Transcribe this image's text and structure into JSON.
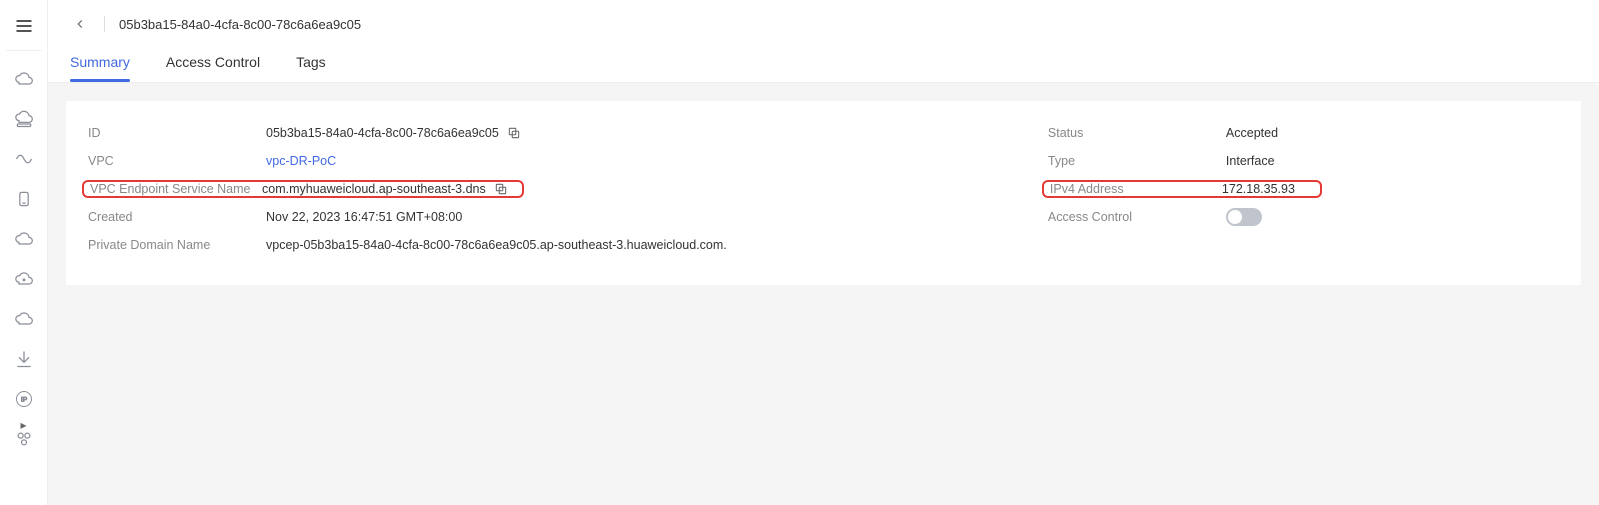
{
  "breadcrumb": {
    "title": "05b3ba15-84a0-4cfa-8c00-78c6a6ea9c05"
  },
  "tabs": [
    {
      "label": "Summary",
      "active": true
    },
    {
      "label": "Access Control",
      "active": false
    },
    {
      "label": "Tags",
      "active": false
    }
  ],
  "details": {
    "left": {
      "id_label": "ID",
      "id_value": "05b3ba15-84a0-4cfa-8c00-78c6a6ea9c05",
      "vpc_label": "VPC",
      "vpc_value": "vpc-DR-PoC",
      "svc_label": "VPC Endpoint Service Name",
      "svc_value": "com.myhuaweicloud.ap-southeast-3.dns",
      "created_label": "Created",
      "created_value": "Nov 22, 2023 16:47:51 GMT+08:00",
      "domain_label": "Private Domain Name",
      "domain_value": "vpcep-05b3ba15-84a0-4cfa-8c00-78c6a6ea9c05.ap-southeast-3.huaweicloud.com."
    },
    "right": {
      "status_label": "Status",
      "status_value": "Accepted",
      "type_label": "Type",
      "type_value": "Interface",
      "ipv4_label": "IPv4 Address",
      "ipv4_value": "172.18.35.93",
      "ac_label": "Access Control"
    }
  }
}
